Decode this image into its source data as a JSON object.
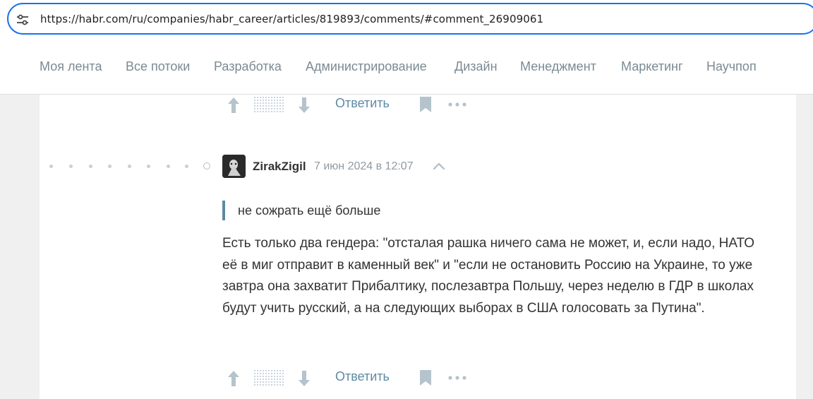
{
  "browser": {
    "url": "https://habr.com/ru/companies/habr_career/articles/819893/comments/#comment_26909061"
  },
  "nav": {
    "items": [
      "Моя лента",
      "Все потоки",
      "Разработка",
      "Администрирование",
      "Дизайн",
      "Менеджмент",
      "Маркетинг",
      "Научпоп"
    ]
  },
  "prev_comment": {
    "reply_label": "Ответить"
  },
  "comment": {
    "username": "ZirakZigil",
    "timestamp": "7 июн 2024 в 12:07",
    "quote": "не сожрать ещё больше",
    "body": "Есть только два гендера: \"отсталая рашка ничего сама не может, и, если надо, НАТО её в миг отправит в каменный век\" и \"если не остановить Россию на Украине, то уже завтра она захватит Прибалтику, послезавтра Польшу, через неделю в ГДР в школах будут учить русский, а на следующих выборах в США голосовать за Путина\".",
    "reply_label": "Ответить"
  },
  "colors": {
    "accent": "#5e8aa3",
    "nav_text": "#7b8a93",
    "browser_focus": "#1a73e8"
  }
}
